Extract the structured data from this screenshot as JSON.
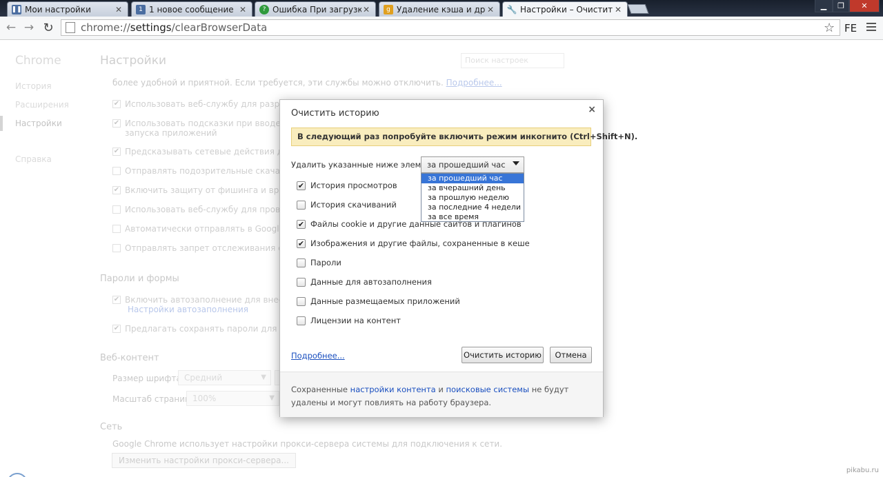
{
  "tabs": [
    {
      "title": "Мои настройки",
      "fav_color": "#4a6da0",
      "fav_glyph": "❚❚"
    },
    {
      "title": "1 новое сообщение",
      "fav_color": "#4a6da0",
      "fav_glyph": "1"
    },
    {
      "title": "Ошибка При загрузке ау",
      "fav_color": "#2f9a3c",
      "fav_glyph": "?"
    },
    {
      "title": "Удаление кэша и других",
      "fav_color": "#e0a020",
      "fav_glyph": "g"
    },
    {
      "title": "Настройки – Очистить ис",
      "fav_color": "#777777",
      "fav_glyph": "🔧"
    }
  ],
  "toolbar": {
    "url_prefix": "chrome://",
    "url_host": "settings",
    "url_path": "/clearBrowserData",
    "profile": "FE"
  },
  "settings": {
    "brand": "Chrome",
    "nav": [
      "История",
      "Расширения",
      "Настройки",
      "Справка"
    ],
    "title": "Настройки",
    "search_placeholder": "Поиск настроек",
    "privacy_text": "более удобной и приятной. Если требуется, эти службы можно отключить.",
    "privacy_link": "Подробнее...",
    "privacy_items": [
      "Использовать веб-службу для разрешения",
      "Использовать подсказки при вводе запросо",
      "Предсказывать сетевые действия для ускор",
      "Отправлять подозрительные скачанные фа",
      "Включить защиту от фишинга и вредоносн",
      "Использовать веб-службу для проверки пр",
      "Автоматически отправлять в Google статис",
      "Отправлять запрет отслеживания с исходя"
    ],
    "privacy_item2_sub": "запуска приложений",
    "passwords_title": "Пароли и формы",
    "autofill": "Включить автозаполнение для внесения да",
    "autofill_link": "Настройки автозаполнения",
    "save_passwords": "Предлагать сохранять пароли для веб-сайт",
    "web_title": "Веб-контент",
    "font_label": "Размер шрифта:",
    "font_value": "Средний",
    "zoom_label": "Масштаб страницы:",
    "zoom_value": "100%",
    "net_title": "Сеть",
    "net_text": "Google Chrome использует настройки прокси-сервера системы для подключения к сети.",
    "proxy_button": "Изменить настройки прокси-сервера..."
  },
  "dialog": {
    "title": "Очистить историю",
    "close": "×",
    "banner": "В следующий раз попробуйте включить режим инкогнито (Ctrl+Shift+N).",
    "range_label": "Удалить указанные ниже элементы:",
    "range_value": "за прошедший час",
    "range_options": [
      "за прошедший час",
      "за вчерашний день",
      "за прошлую неделю",
      "за последние 4 недели",
      "за все время"
    ],
    "items": [
      {
        "label": "История просмотров",
        "checked": true
      },
      {
        "label": "История скачиваний",
        "checked": false
      },
      {
        "label": "Файлы cookie и другие данные сайтов и плагинов",
        "checked": true
      },
      {
        "label": "Изображения и другие файлы, сохраненные в кеше",
        "checked": true
      },
      {
        "label": "Пароли",
        "checked": false
      },
      {
        "label": "Данные для автозаполнения",
        "checked": false
      },
      {
        "label": "Данные размещаемых приложений",
        "checked": false
      },
      {
        "label": "Лицензии на контент",
        "checked": false
      }
    ],
    "more_link": "Подробнее...",
    "clear_button": "Очистить историю",
    "cancel_button": "Отмена",
    "footer_pre": "Сохраненные ",
    "footer_link1": "настройки контента",
    "footer_mid": " и ",
    "footer_link2": "поисковые системы",
    "footer_post": " не будут удалены и могут повлиять на работу браузера."
  },
  "watermark": "pikabu.ru"
}
